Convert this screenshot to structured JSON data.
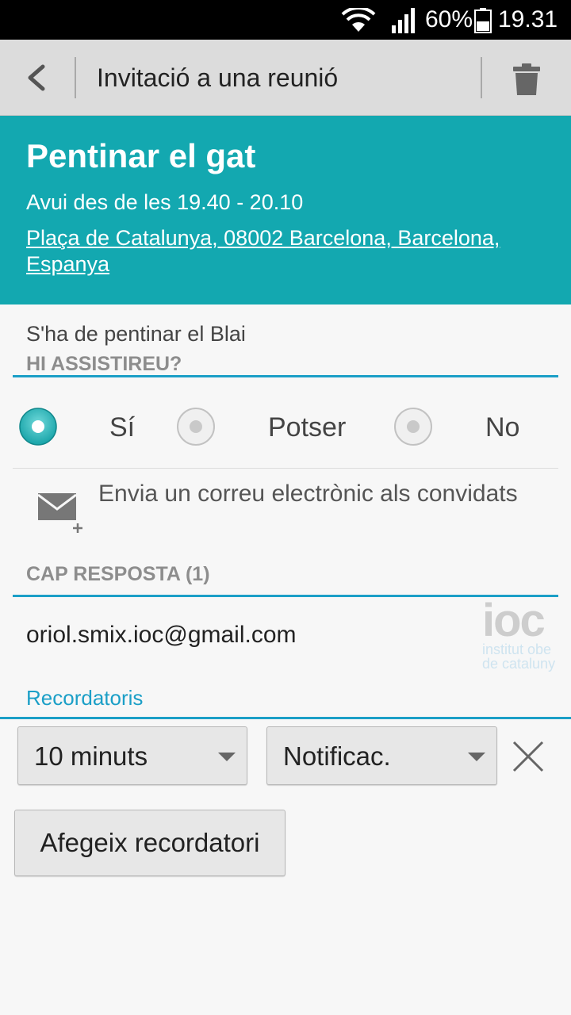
{
  "status_bar": {
    "battery_percent": "60%",
    "time": "19.31"
  },
  "action_bar": {
    "title": "Invitació a una reunió"
  },
  "event": {
    "title": "Pentinar el gat",
    "time": "Avui des de les 19.40 - 20.10",
    "location": "Plaça de Catalunya, 08002 Barcelona, Barcelona, Espanya",
    "description": "S'ha de pentinar el Blai"
  },
  "attendance": {
    "heading": "HI ASSISTIREU?",
    "options": [
      {
        "label": "Sí",
        "selected": true
      },
      {
        "label": "Potser",
        "selected": false
      },
      {
        "label": "No",
        "selected": false
      }
    ]
  },
  "email_guests": {
    "label": "Envia un correu electrònic als convidats",
    "icon": "mail-add-icon"
  },
  "no_response": {
    "heading": "CAP RESPOSTA (1)",
    "email": "oriol.smix.ioc@gmail.com",
    "logo_text": "ioc",
    "logo_sub_1": "institut obe",
    "logo_sub_2": "de cataluny"
  },
  "reminders": {
    "label": "Recordatoris",
    "duration_value": "10 minuts",
    "method_value": "Notificac.",
    "add_label": "Afegeix recordatori"
  },
  "colors": {
    "accent": "#13a8b0",
    "blue": "#1b9fc7",
    "actionbar": "#dcdcdc"
  }
}
